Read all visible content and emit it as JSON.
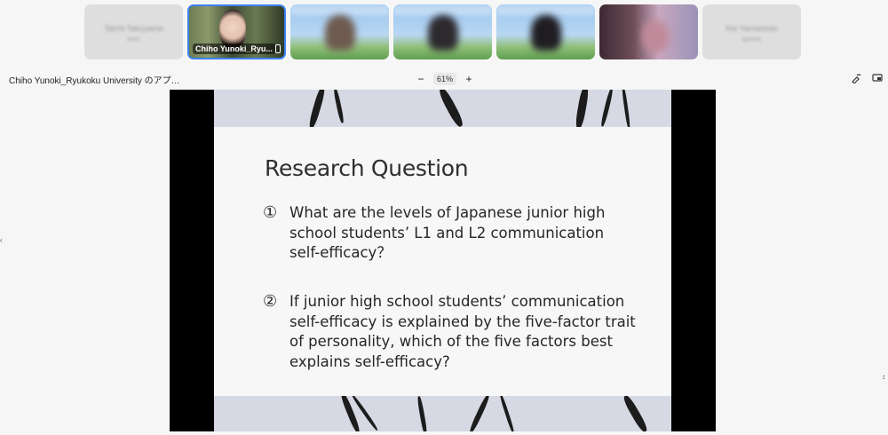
{
  "participants": [
    {
      "type": "off",
      "name": "Taichi Takuyama",
      "sub": "(me)"
    },
    {
      "type": "active",
      "name": "Chiho Yunoki_Ryu..."
    },
    {
      "type": "video"
    },
    {
      "type": "video"
    },
    {
      "type": "video"
    },
    {
      "type": "dark"
    },
    {
      "type": "off",
      "name": "Kei Yamamoto",
      "sub": "(guest)"
    }
  ],
  "toolbar": {
    "share_title": "Chiho Yunoki_Ryukoku University のアプ…",
    "zoom_out": "−",
    "zoom_level": "61%",
    "zoom_in": "+"
  },
  "slide": {
    "title": "Research Question",
    "questions": [
      {
        "number": "①",
        "text": "What are the levels of Japanese junior high\nschool students’ L1 and L2 communication\nself-efficacy？"
      },
      {
        "number": "②",
        "text": "If junior high school students’ communication\nself-efficacy is explained by the five-factor trait\nof personality, which of the five factors best\nexplains self-efficacy?"
      }
    ]
  }
}
